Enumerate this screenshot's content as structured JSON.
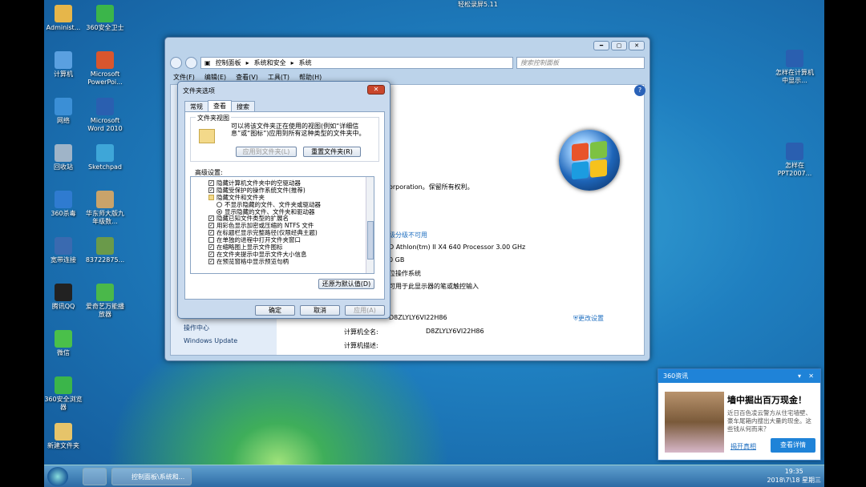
{
  "screen": {
    "recorder": "轻松录屏5.11"
  },
  "desktop_icons_left": [
    {
      "label": "Administ...",
      "color": "#e6b64a"
    },
    {
      "label": "360安全卫士",
      "color": "#3bb54a"
    },
    {
      "label": "计算机",
      "color": "#5aa0e0"
    },
    {
      "label": "Microsoft PowerPoi...",
      "color": "#d8562e"
    },
    {
      "label": "网络",
      "color": "#3b8fd6"
    },
    {
      "label": "Microsoft Word 2010",
      "color": "#2a5fb0"
    },
    {
      "label": "回收站",
      "color": "#9fb4c8"
    },
    {
      "label": "Sketchpad",
      "color": "#3ea6d8"
    },
    {
      "label": "360杀毒",
      "color": "#2f7bd0"
    },
    {
      "label": "华东师大版九年级数...",
      "color": "#c9a36a"
    },
    {
      "label": "宽带连接",
      "color": "#3a6ab0"
    },
    {
      "label": "83722875...",
      "color": "#6a9a4a"
    },
    {
      "label": "腾讯QQ",
      "color": "#222222"
    },
    {
      "label": "爱奇艺万能播放器",
      "color": "#4ab84a"
    },
    {
      "label": "微信",
      "color": "#4ac04a"
    },
    {
      "label": "360安全浏览器",
      "color": "#3bb54a"
    },
    {
      "label": "新建文件夹",
      "color": "#e6c46a"
    }
  ],
  "desktop_icons_right": [
    {
      "label": "怎样在计算机中显示...",
      "color": "#2a5fb0"
    },
    {
      "label": "怎样在 PPT2007...",
      "color": "#2a5fb0"
    }
  ],
  "window": {
    "buttons": {
      "min": "━",
      "max": "▢",
      "close": "✕"
    },
    "breadcrumb": [
      "控制面板",
      "系统和安全",
      "系统"
    ],
    "search_placeholder": "搜索控制面板",
    "menu": [
      "文件(F)",
      "编辑(E)",
      "查看(V)",
      "工具(T)",
      "帮助(H)"
    ],
    "left_links": [
      "操作中心",
      "Windows Update"
    ],
    "lines": {
      "copyright": "orporation。保留所有权利。",
      "rating": "级分级不可用",
      "processor": "D Athlon(tm) II X4 640 Processor   3.00 GHz",
      "ram": "0 GB",
      "os_type": "位操作系统",
      "pen": "可用于此显示器的笔或触控输入",
      "change_settings": "更改设置",
      "computer_name_val": "D8ZLYLY6VI22H86",
      "full_name_label": "计算机全名:",
      "full_name_val": "D8ZLYLY6VI22H86",
      "desc_label": "计算机描述:"
    },
    "help": "?"
  },
  "dialog": {
    "title": "文件夹选项",
    "close": "✕",
    "tabs": [
      "常规",
      "查看",
      "搜索"
    ],
    "active_tab": 1,
    "folder_views_legend": "文件夹视图",
    "folder_views_text": "可以将该文件夹正在使用的视图(例如“详细信息”或“图标”)应用到所有这种类型的文件夹中。",
    "apply_to_folders": "应用到文件夹(L)",
    "reset_folders": "重置文件夹(R)",
    "advanced_label": "高级设置:",
    "settings": [
      {
        "type": "cb",
        "checked": true,
        "text": "隐藏计算机文件夹中的空驱动器"
      },
      {
        "type": "cb",
        "checked": true,
        "text": "隐藏受保护的操作系统文件(推荐)"
      },
      {
        "type": "folder",
        "checked": false,
        "text": "隐藏文件和文件夹"
      },
      {
        "type": "rb",
        "checked": false,
        "text": "不显示隐藏的文件、文件夹或驱动器"
      },
      {
        "type": "rb",
        "checked": true,
        "text": "显示隐藏的文件、文件夹和驱动器"
      },
      {
        "type": "cb",
        "checked": true,
        "text": "隐藏已知文件类型的扩展名"
      },
      {
        "type": "cb",
        "checked": true,
        "text": "用彩色显示加密或压缩的 NTFS 文件"
      },
      {
        "type": "cb",
        "checked": true,
        "text": "在标题栏显示完整路径(仅限经典主题)"
      },
      {
        "type": "cb",
        "checked": false,
        "text": "在单独的进程中打开文件夹窗口"
      },
      {
        "type": "cb",
        "checked": true,
        "text": "在缩略图上显示文件图标"
      },
      {
        "type": "cb",
        "checked": true,
        "text": "在文件夹提示中显示文件大小信息"
      },
      {
        "type": "cb",
        "checked": true,
        "text": "在预览窗格中显示预览句柄"
      }
    ],
    "restore_defaults": "还原为默认值(D)",
    "ok": "确定",
    "cancel": "取消",
    "apply": "应用(A)"
  },
  "news": {
    "header": "360资讯",
    "title": "墙中掘出百万现金！",
    "body": "近日百色凌云警方从住宅墙壁、豪车尾箱内搜出大量的现金。这些钱从何而来？",
    "link": "揭开真相",
    "button": "查看详情"
  },
  "taskbar": {
    "item": "控制面板\\系统和...",
    "time": "19:35",
    "date": "2018\\7\\18 星期三"
  },
  "colors": {
    "accent": "#1f83d8",
    "taskbar": "#2c6aa4"
  }
}
